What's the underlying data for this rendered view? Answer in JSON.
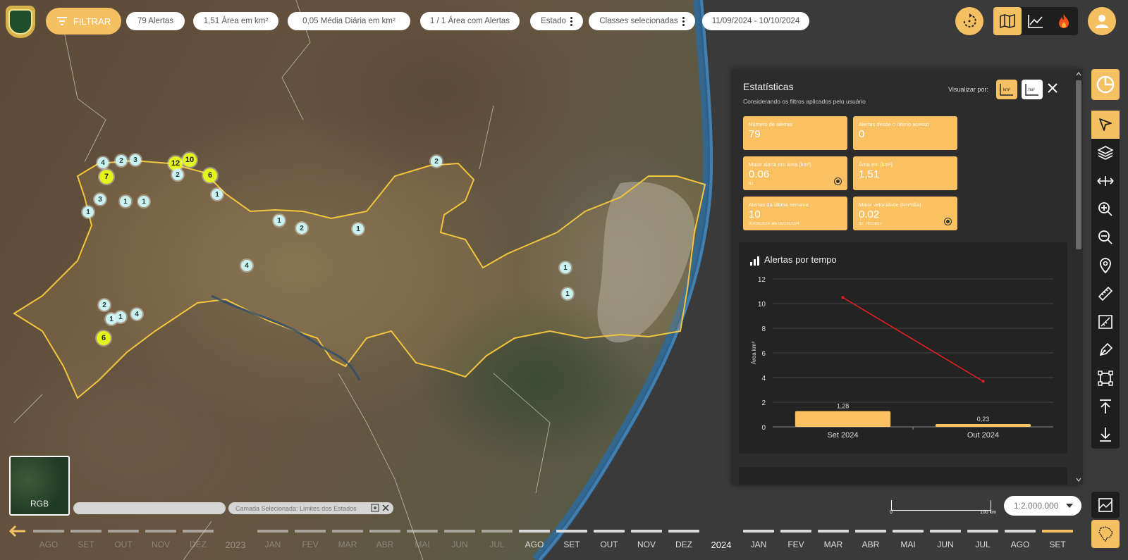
{
  "header": {
    "filter_label": "FILTRAR",
    "chips": [
      {
        "label": "79 Alertas"
      },
      {
        "label": "1,51 Área em km²"
      },
      {
        "label": "0,05 Média Diária em km²"
      },
      {
        "label": "1 / 1 Área com Alertas"
      },
      {
        "label": "Estado"
      },
      {
        "label": "Classes selecionadas"
      },
      {
        "label": "11/09/2024 - 10/10/2024"
      }
    ]
  },
  "view_modes": [
    "map-icon",
    "line-chart-icon",
    "fire-icon"
  ],
  "stats": {
    "title": "Estatísticas",
    "subtitle": "Considerando os filtros aplicados pelo usuário",
    "view_by_label": "Visualizar por:",
    "view_by_options": [
      "km²",
      "ha²"
    ],
    "cards": [
      {
        "label": "Número de alertas",
        "value": "79",
        "sub": ""
      },
      {
        "label": "Alertas desde o último acesso",
        "value": "0",
        "sub": ""
      },
      {
        "label": "Maior alerta em área (km²)",
        "value": "0.06",
        "sub": "ID:"
      },
      {
        "label": "Área em (km²)",
        "value": "1,51",
        "sub": ""
      },
      {
        "label": "Alertas da última semana",
        "value": "10",
        "sub": "30/09/2024 até 06/10/2024"
      },
      {
        "label": "Maior velocidade (km²/dia)",
        "value": "0.02",
        "sub": "ID: 7810837"
      }
    ]
  },
  "chart_data": {
    "type": "bar",
    "title": "Alertas por tempo",
    "ylabel": "Área km²",
    "categories": [
      "Set 2024",
      "Out 2024"
    ],
    "series": [
      {
        "type": "bar",
        "values": [
          1.28,
          0.23
        ],
        "labels": [
          "1,28",
          "0,23"
        ],
        "color": "#f9c161"
      },
      {
        "type": "line",
        "values": [
          10.5,
          3.7
        ],
        "color": "#e0201e"
      }
    ],
    "ylim": [
      0,
      12
    ],
    "yticks": [
      0,
      2,
      4,
      6,
      8,
      10,
      12
    ],
    "grid": true
  },
  "markers": [
    {
      "label": "4"
    },
    {
      "label": "2"
    },
    {
      "label": "3"
    },
    {
      "label": "12"
    },
    {
      "label": "10"
    },
    {
      "label": "7"
    },
    {
      "label": "2"
    },
    {
      "label": "6"
    },
    {
      "label": "3"
    },
    {
      "label": "1"
    },
    {
      "label": "1"
    },
    {
      "label": "1"
    },
    {
      "label": "1"
    },
    {
      "label": "2"
    },
    {
      "label": "1"
    },
    {
      "label": "2"
    },
    {
      "label": "1"
    },
    {
      "label": "4"
    },
    {
      "label": "2"
    },
    {
      "label": "1"
    },
    {
      "label": "1"
    },
    {
      "label": "4"
    },
    {
      "label": "6"
    },
    {
      "label": "1"
    },
    {
      "label": "1"
    }
  ],
  "minimap": {
    "label": "RGB"
  },
  "layer": {
    "label": "Camada Selecionada: Limites dos Estados"
  },
  "scale": {
    "left": "0",
    "right": "100 km",
    "zoom": "1:2.000.000"
  },
  "timeline": [
    {
      "label": "AGO"
    },
    {
      "label": "SET"
    },
    {
      "label": "OUT"
    },
    {
      "label": "NOV"
    },
    {
      "label": "DEZ"
    },
    {
      "label": "2023",
      "year": true
    },
    {
      "label": "JAN"
    },
    {
      "label": "FEV"
    },
    {
      "label": "MAR"
    },
    {
      "label": "ABR"
    },
    {
      "label": "MAI"
    },
    {
      "label": "JUN"
    },
    {
      "label": "JUL"
    },
    {
      "label": "AGO"
    },
    {
      "label": "SET"
    },
    {
      "label": "OUT"
    },
    {
      "label": "NOV"
    },
    {
      "label": "DEZ"
    },
    {
      "label": "2024",
      "year": true
    },
    {
      "label": "JAN"
    },
    {
      "label": "FEV"
    },
    {
      "label": "MAR"
    },
    {
      "label": "ABR"
    },
    {
      "label": "MAI"
    },
    {
      "label": "JUN"
    },
    {
      "label": "JUL"
    },
    {
      "label": "AGO"
    },
    {
      "label": "SET",
      "active": true
    }
  ],
  "colors": {
    "accent": "#f5c061",
    "boundary": "#f2c53d",
    "marker": "#c9f1ef",
    "marker_big": "#e4f51c"
  }
}
